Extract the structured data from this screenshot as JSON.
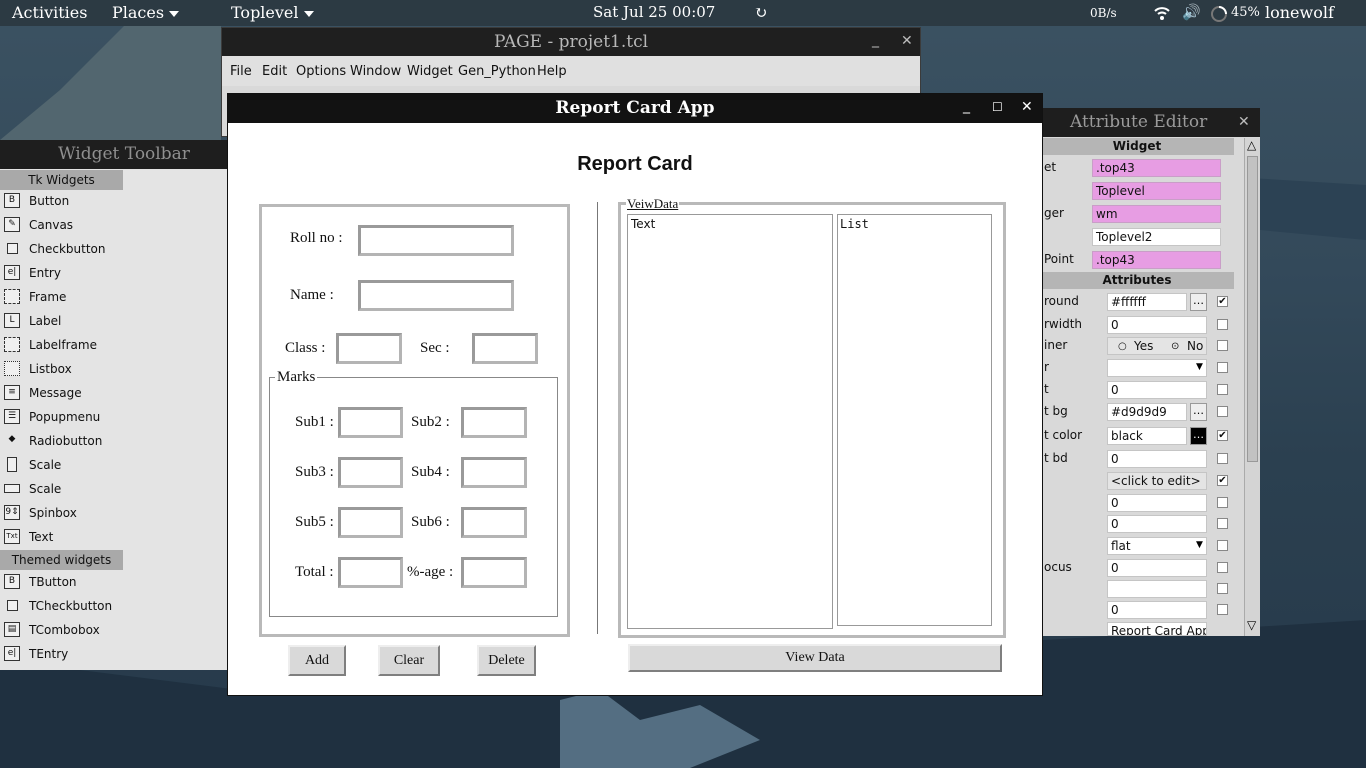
{
  "topbar": {
    "activities": "Activities",
    "places": "Places",
    "app_menu": "Toplevel",
    "clock": "Sat Jul 25  00:07",
    "network_rate": "0B/s",
    "battery": "45%",
    "user": "lonewolf"
  },
  "page_window": {
    "title": "PAGE - projet1.tcl",
    "menu": [
      "File",
      "Edit",
      "Options",
      "Window",
      "Widget",
      "Gen_Python",
      "Help"
    ]
  },
  "widget_toolbar": {
    "title": "Widget Toolbar",
    "tk_section": "Tk Widgets",
    "tk_items": [
      "Button",
      "Canvas",
      "Checkbutton",
      "Entry",
      "Frame",
      "Label",
      "Labelframe",
      "Listbox",
      "Message",
      "Popupmenu",
      "Radiobutton",
      "Scale",
      "Scale",
      "Spinbox",
      "Text"
    ],
    "themed_section": "Themed widgets",
    "themed_items": [
      "TButton",
      "TCheckbutton",
      "TCombobox",
      "TEntry"
    ]
  },
  "attribute_editor": {
    "title": "Attribute Editor",
    "widget_header": "Widget",
    "widget_rows": [
      {
        "label": "et",
        "value": ".top43"
      },
      {
        "label": "",
        "value": "Toplevel"
      },
      {
        "label": "ger",
        "value": "wm"
      },
      {
        "label": "",
        "value": "Toplevel2"
      },
      {
        "label": " Point",
        "value": ".top43"
      }
    ],
    "attributes_header": "Attributes",
    "attr_rows": [
      {
        "label": "round",
        "value": "#ffffff"
      },
      {
        "label": "rwidth",
        "value": "0"
      },
      {
        "label": "iner",
        "yes": "Yes",
        "no": "No"
      },
      {
        "label": "r",
        "value": ""
      },
      {
        "label": "t",
        "value": "0"
      },
      {
        "label": "t bg",
        "value": "#d9d9d9"
      },
      {
        "label": "t color",
        "value": "black"
      },
      {
        "label": "t bd",
        "value": "0"
      },
      {
        "label": "",
        "value": "<click to edit>"
      },
      {
        "label": "",
        "value": "0"
      },
      {
        "label": "",
        "value": "0"
      },
      {
        "label": "",
        "value": "flat"
      },
      {
        "label": "ocus",
        "value": "0"
      },
      {
        "label": "",
        "value": ""
      },
      {
        "label": "",
        "value": "0"
      },
      {
        "label": "",
        "value": "Report Card App"
      }
    ]
  },
  "report_app": {
    "title": "Report Card App",
    "heading": "Report Card",
    "roll_label": "Roll no :",
    "name_label": "Name :",
    "class_label": "Class :",
    "sec_label": "Sec :",
    "marks_title": "Marks",
    "sub1": "Sub1 :",
    "sub2": "Sub2 :",
    "sub3": "Sub3 :",
    "sub4": "Sub4 :",
    "sub5": "Sub5 :",
    "sub6": "Sub6 :",
    "total": "Total :",
    "pct": "%-age :",
    "add": "Add",
    "clear": "Clear",
    "delete": "Delete",
    "view_title": "VeiwData",
    "text_box": "Text",
    "list_box": "List",
    "view_button": "View Data"
  }
}
